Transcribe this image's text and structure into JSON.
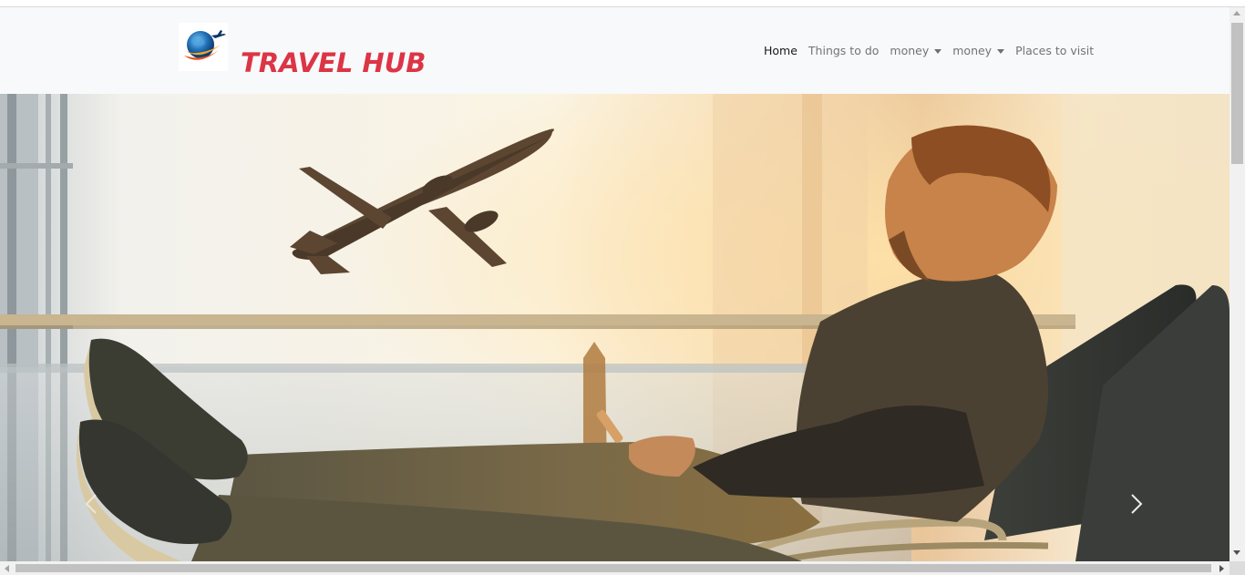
{
  "brand": {
    "name": "TRAVEL HUB",
    "logo_icon": "globe-airplane-logo",
    "brand_color": "#dc3545"
  },
  "nav": {
    "items": [
      {
        "label": "Home",
        "active": true,
        "dropdown": false
      },
      {
        "label": "Things to do",
        "active": false,
        "dropdown": false
      },
      {
        "label": "money",
        "active": false,
        "dropdown": true
      },
      {
        "label": "money",
        "active": false,
        "dropdown": true
      },
      {
        "label": "Places to visit",
        "active": false,
        "dropdown": false
      }
    ]
  },
  "carousel": {
    "slide_image": "man-in-airport-watching-plane",
    "prev_icon": "chevron-left-icon",
    "next_icon": "chevron-right-icon"
  }
}
